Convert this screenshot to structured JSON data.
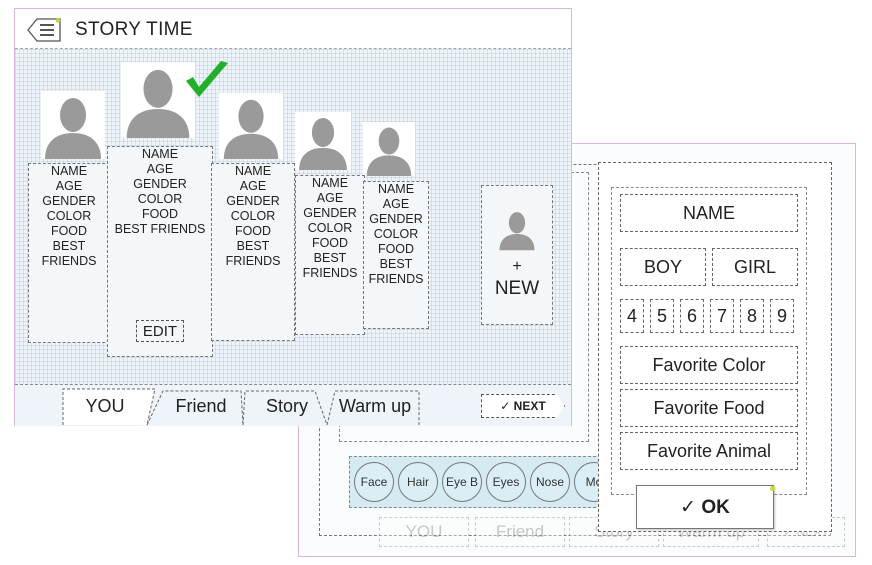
{
  "app": {
    "title": "STORY TIME"
  },
  "profiles": [
    {
      "lines": [
        "NAME",
        "AGE",
        "GENDER",
        "COLOR",
        "FOOD",
        "BEST",
        "FRIENDS"
      ]
    },
    {
      "lines": [
        "NAME",
        "AGE",
        "GENDER",
        "COLOR",
        "FOOD",
        "BEST FRIENDS"
      ],
      "selected": true,
      "edit_label": "EDIT"
    },
    {
      "lines": [
        "NAME",
        "AGE",
        "GENDER",
        "COLOR",
        "FOOD",
        "BEST",
        "FRIENDS"
      ]
    },
    {
      "lines": [
        "NAME",
        "AGE",
        "GENDER",
        "COLOR",
        "FOOD",
        "BEST",
        "FRIENDS"
      ]
    },
    {
      "lines": [
        "NAME",
        "AGE",
        "GENDER",
        "COLOR",
        "FOOD",
        "BEST",
        "FRIENDS"
      ]
    }
  ],
  "new_profile": {
    "plus": "+",
    "label": "NEW"
  },
  "tabs": [
    {
      "label": "YOU",
      "active": true
    },
    {
      "label": "Friend"
    },
    {
      "label": "Story"
    },
    {
      "label": "Warm up"
    }
  ],
  "next_button": {
    "label": "✓ NEXT"
  },
  "back_screen": {
    "tabs": [
      "YOU",
      "Friend",
      "Story",
      "Warm up"
    ],
    "next_label": "✓ NEXT",
    "features": [
      "Face",
      "Hair",
      "Eye B",
      "Eyes",
      "Nose",
      "Mo"
    ]
  },
  "dialog": {
    "name_label": "NAME",
    "gender_options": [
      "BOY",
      "GIRL"
    ],
    "ages": [
      "4",
      "5",
      "6",
      "7",
      "8",
      "9"
    ],
    "favorites": [
      "Favorite Color",
      "Favorite Food",
      "Favorite Animal"
    ],
    "ok_label": "✓ OK"
  },
  "colors": {
    "accent_green": "#22b02a",
    "highlight_yellow": "#c8d830",
    "avatar_gray": "#9a9a9a"
  },
  "icons": {
    "back": "list-back-icon",
    "avatar": "person-silhouette-icon",
    "check": "checkmark-icon"
  }
}
